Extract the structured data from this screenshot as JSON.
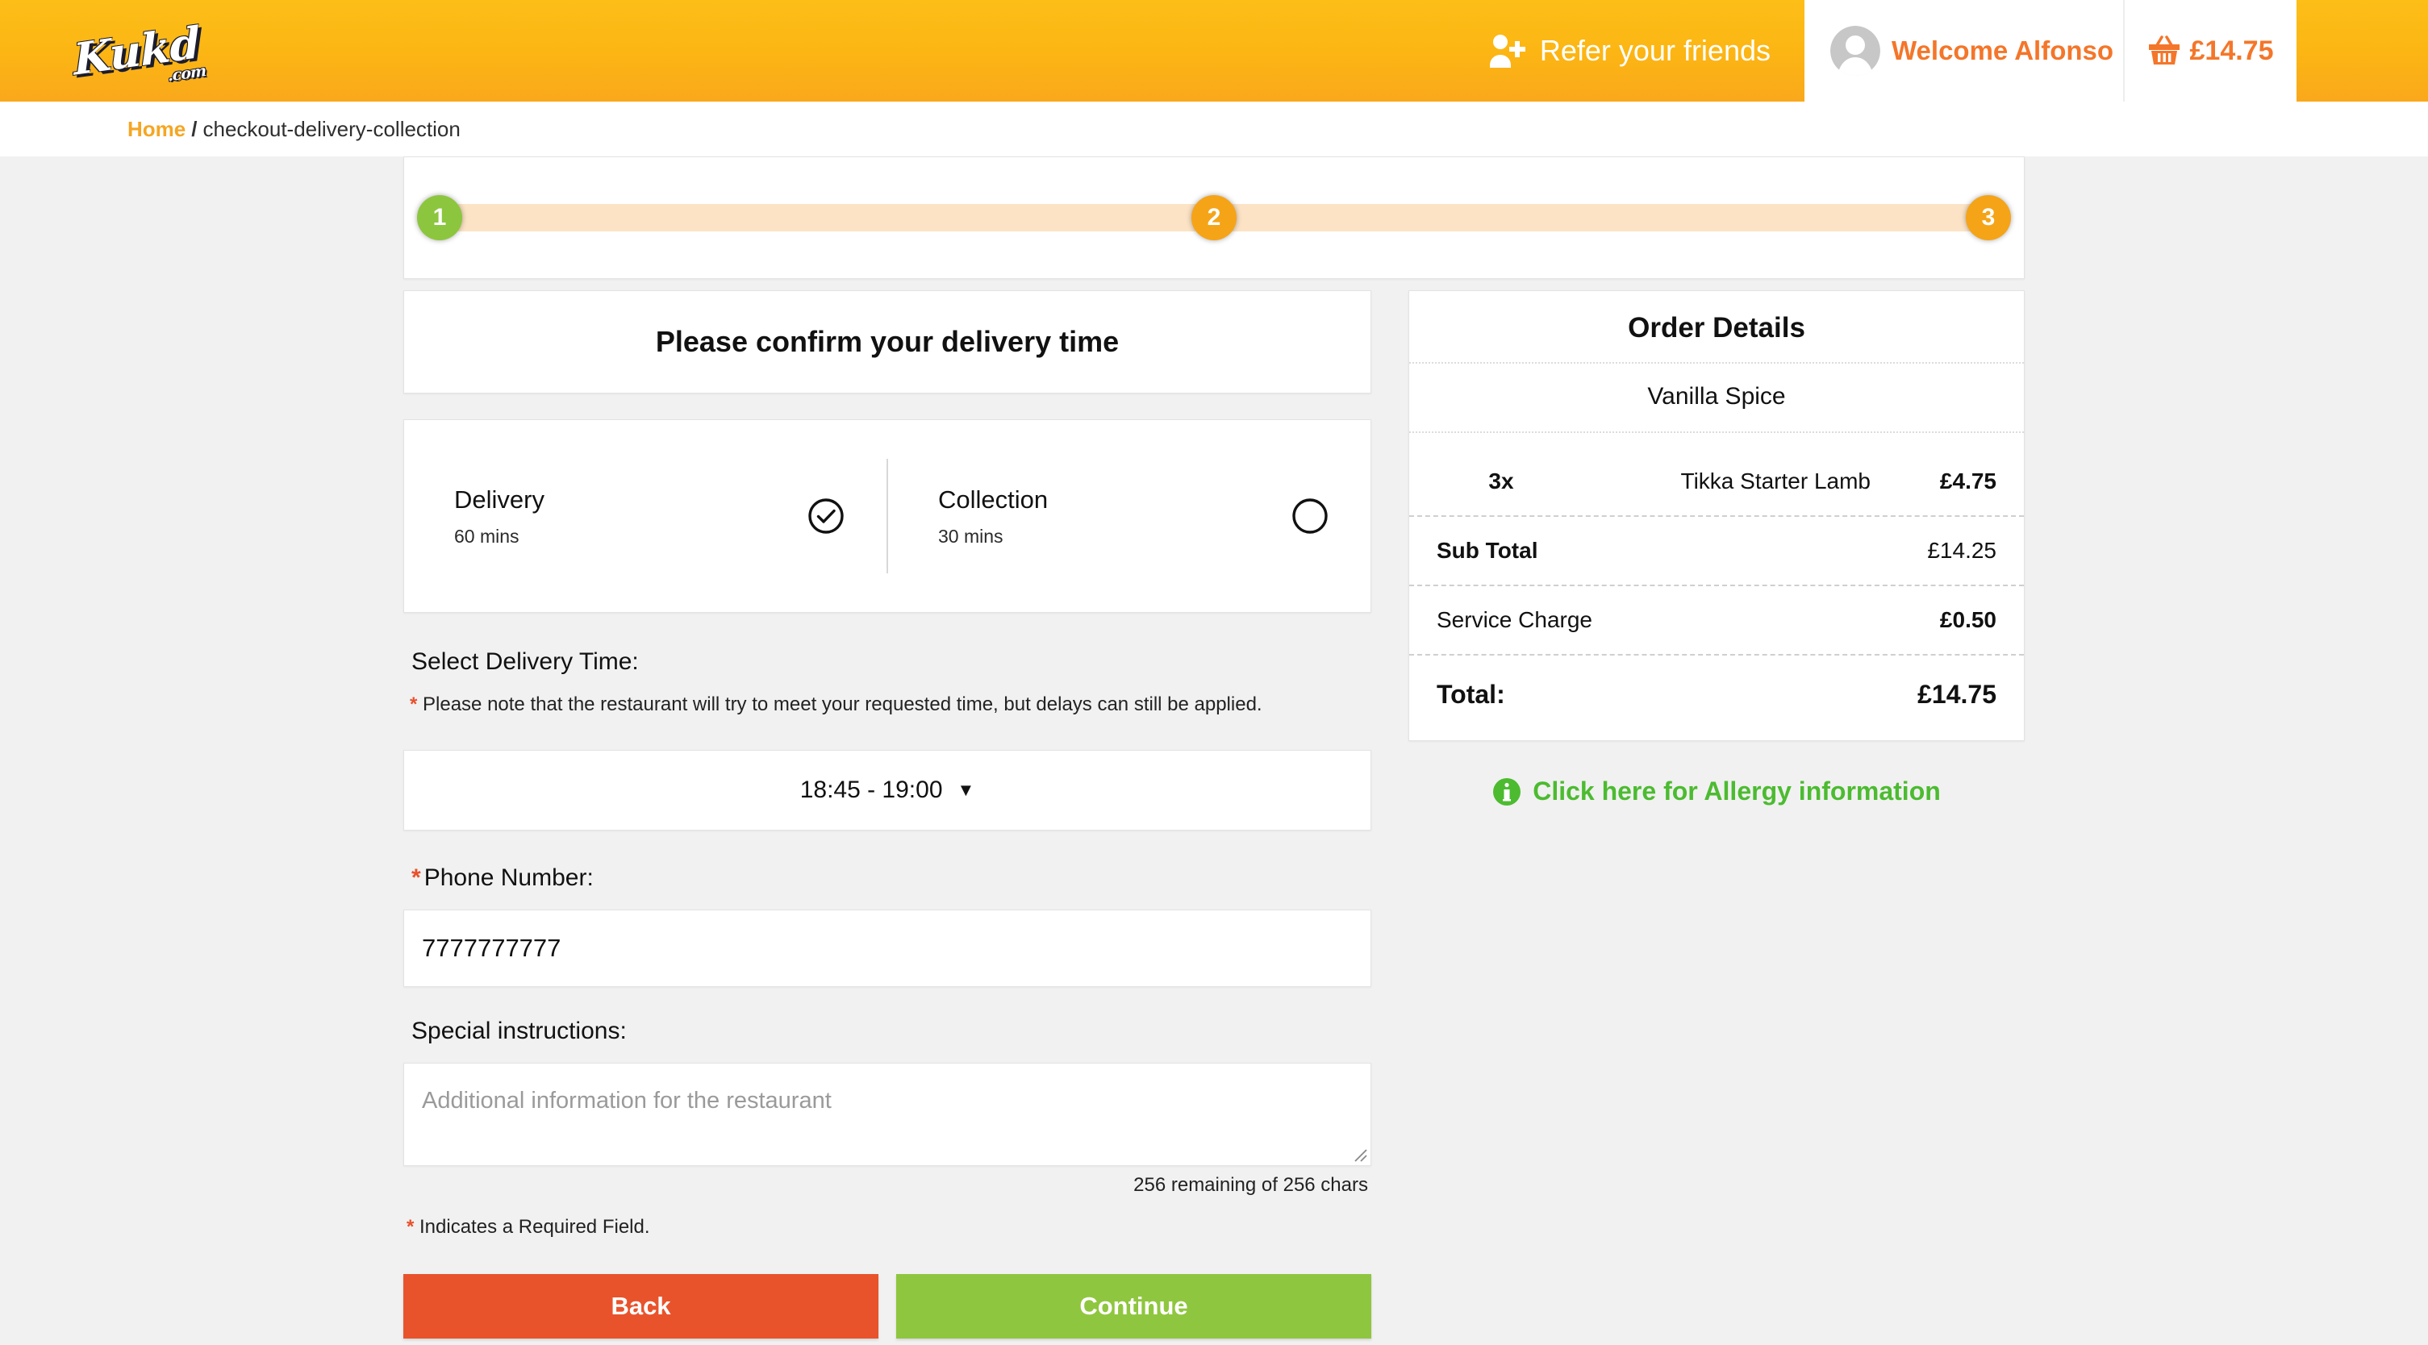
{
  "header": {
    "logo_text": "Kukd",
    "logo_suffix": ".com",
    "refer_label": "Refer your friends",
    "refer_icon": "person-plus-icon",
    "avatar_icon": "avatar-icon",
    "welcome_text": "Welcome Alfonso",
    "basket_icon": "basket-icon",
    "basket_amount": "£14.75",
    "colors": {
      "bar_start": "#fdbe18",
      "bar_end": "#f9a81b",
      "accent_orange": "#f4762a"
    }
  },
  "breadcrumb": {
    "home_label": "Home",
    "separator": "/",
    "current": "checkout-delivery-collection"
  },
  "stepper": {
    "steps": [
      {
        "number": "1",
        "state": "complete",
        "color": "#8cc63e"
      },
      {
        "number": "2",
        "state": "active",
        "color": "#f5a418"
      },
      {
        "number": "3",
        "state": "pending",
        "color": "#f5a418"
      }
    ],
    "track_color": "#fce3c5"
  },
  "main": {
    "confirm_title": "Please confirm your delivery time",
    "options": [
      {
        "name": "Delivery",
        "mins": "60 mins",
        "selected": true,
        "icon": "check-circle-icon"
      },
      {
        "name": "Collection",
        "mins": "30 mins",
        "selected": false,
        "icon": "circle-icon"
      }
    ],
    "select_time_label": "Select Delivery Time:",
    "required_marker": "*",
    "time_note": "Please note that the restaurant will try to meet your requested time, but delays can still be applied.",
    "time_value": "18:45 - 19:00",
    "time_caret": "▼",
    "phone_label": "Phone Number:",
    "phone_value": "7777777777",
    "phone_placeholder": "",
    "instructions_label": "Special instructions:",
    "instructions_value": "",
    "instructions_placeholder": "Additional information for the restaurant",
    "char_count": "256 remaining of 256 chars",
    "required_field_note": "Indicates a Required Field.",
    "back_label": "Back",
    "continue_label": "Continue",
    "back_color": "#e8532b",
    "continue_color": "#8fc63f"
  },
  "order": {
    "title": "Order Details",
    "restaurant": "Vanilla Spice",
    "items": [
      {
        "qty": "3x",
        "name": "Tikka Starter Lamb",
        "price": "£4.75"
      }
    ],
    "summary": [
      {
        "label": "Sub Total",
        "value": "£14.25"
      },
      {
        "label": "Service Charge",
        "value": "£0.50"
      }
    ],
    "total_label": "Total:",
    "total_value": "£14.75",
    "allergy_icon": "info-circle-icon",
    "allergy_label": "Click here for Allergy information",
    "allergy_color": "#4cbb30"
  }
}
